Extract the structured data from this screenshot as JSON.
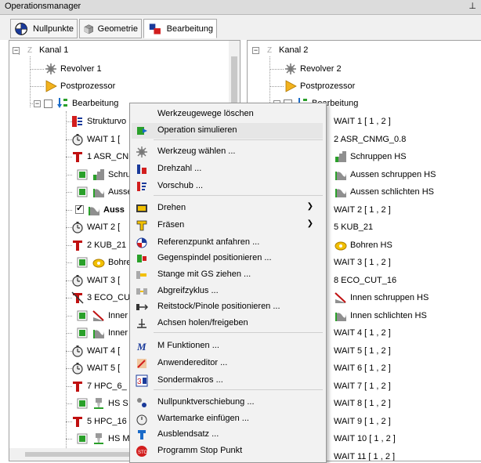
{
  "window": {
    "title": "Operationsmanager",
    "pin_icon": "pin-icon"
  },
  "tabs": [
    {
      "label": "Nullpunkte",
      "icon": "crosshair-icon",
      "active": false
    },
    {
      "label": "Geometrie",
      "icon": "cube-icon",
      "active": false
    },
    {
      "label": "Bearbeitung",
      "icon": "machining-icon",
      "active": true
    }
  ],
  "left_tree": {
    "kanal": "Kanal 1",
    "revolver": "Revolver 1",
    "postprozessor": "Postprozessor",
    "bearbeitung": "Bearbeitung",
    "items": [
      {
        "label": "Strukturvo",
        "icon": "structure-icon",
        "checkbox": false
      },
      {
        "label": "WAIT 1 [",
        "icon": "stopwatch-icon",
        "checkbox": false
      },
      {
        "label": "1 ASR_CN",
        "icon": "tool-t-icon",
        "checkbox": false
      },
      {
        "label": "Schru",
        "icon": "roughing-icon",
        "checkbox": true,
        "checked": false
      },
      {
        "label": "Aussen",
        "icon": "contour-icon",
        "checkbox": true,
        "checked": false
      },
      {
        "label": "Auss",
        "icon": "contour-icon",
        "checkbox": true,
        "checked": true,
        "bold": true
      },
      {
        "label": "WAIT 2 [",
        "icon": "stopwatch-icon",
        "checkbox": false
      },
      {
        "label": "2 KUB_21",
        "icon": "tool-t-icon",
        "checkbox": false
      },
      {
        "label": "Bohre",
        "icon": "drill-icon",
        "checkbox": true,
        "checked": false
      },
      {
        "label": "WAIT 3 [",
        "icon": "stopwatch-icon",
        "checkbox": false
      },
      {
        "label": "3 ECO_CU",
        "icon": "tool-t-crossed-icon",
        "checkbox": false
      },
      {
        "label": "Inner",
        "icon": "cutoff-icon",
        "checkbox": true,
        "checked": false
      },
      {
        "label": "Inner",
        "icon": "contour-icon",
        "checkbox": true,
        "checked": false
      },
      {
        "label": "WAIT 4 [",
        "icon": "stopwatch-icon",
        "checkbox": false
      },
      {
        "label": "WAIT 5 [",
        "icon": "stopwatch-icon",
        "checkbox": false
      },
      {
        "label": "7 HPC_6_",
        "icon": "tool-t-icon",
        "checkbox": false
      },
      {
        "label": "HS S",
        "icon": "spindle-icon",
        "checkbox": true,
        "checked": false
      },
      {
        "label": "5 HPC_16",
        "icon": "tool-t-icon",
        "checkbox": false
      },
      {
        "label": "HS M",
        "icon": "spindle-icon",
        "checkbox": true,
        "checked": false
      }
    ]
  },
  "right_tree": {
    "kanal": "Kanal 2",
    "revolver": "Revolver 2",
    "postprozessor": "Postprozessor",
    "bearbeitung": "Bearbeitung",
    "items": [
      {
        "label": "WAIT 1 [ 1 , 2 ]"
      },
      {
        "label": "2 ASR_CNMG_0.8"
      },
      {
        "label": "Schruppen HS",
        "icon": "roughing-icon"
      },
      {
        "label": "Aussen schruppen HS",
        "icon": "contour-icon"
      },
      {
        "label": "Aussen schlichten HS",
        "icon": "contour-icon"
      },
      {
        "label": "WAIT 2 [ 1 , 2 ]"
      },
      {
        "label": "5 KUB_21"
      },
      {
        "label": "Bohren HS",
        "icon": "drill-icon"
      },
      {
        "label": "WAIT 3 [ 1 , 2 ]"
      },
      {
        "label": "8 ECO_CUT_16"
      },
      {
        "label": "Innen schruppen HS",
        "icon": "cutoff-icon"
      },
      {
        "label": "Innen schlichten HS",
        "icon": "contour-icon"
      },
      {
        "label": "WAIT 4 [ 1 , 2 ]"
      },
      {
        "label": "WAIT 5 [ 1 , 2 ]"
      },
      {
        "label": "WAIT 6 [ 1 , 2 ]"
      },
      {
        "label": "WAIT 7 [ 1 , 2 ]"
      },
      {
        "label": "WAIT 8 [ 1 , 2 ]"
      },
      {
        "label": "WAIT 9 [ 1 , 2 ]"
      },
      {
        "label": "WAIT 10 [ 1 , 2 ]"
      },
      {
        "label": "WAIT 11 [ 1 , 2 ]"
      }
    ]
  },
  "context_menu": {
    "items": [
      {
        "label": "Werkzeugewege löschen",
        "icon": "none"
      },
      {
        "label": "Operation simulieren",
        "icon": "simulate-icon",
        "highlighted": true
      },
      {
        "label": "Werkzeug wählen ...",
        "icon": "tool-select-icon"
      },
      {
        "label": "Drehzahl ...",
        "icon": "speed-icon"
      },
      {
        "label": "Vorschub ...",
        "icon": "feed-icon"
      },
      {
        "label": "Drehen",
        "icon": "turning-icon",
        "submenu": true
      },
      {
        "label": "Fräsen",
        "icon": "milling-icon",
        "submenu": true
      },
      {
        "label": "Referenzpunkt anfahren ...",
        "icon": "reference-icon"
      },
      {
        "label": "Gegenspindel positionieren ...",
        "icon": "counter-spindle-icon"
      },
      {
        "label": "Stange mit GS ziehen ...",
        "icon": "bar-pull-icon"
      },
      {
        "label": "Abgreifzyklus ...",
        "icon": "pickup-icon"
      },
      {
        "label": "Reitstock/Pinole positionieren ...",
        "icon": "tailstock-icon"
      },
      {
        "label": "Achsen holen/freigeben",
        "icon": "axes-icon"
      },
      {
        "label": "M Funktionen ...",
        "icon": "m-function-icon"
      },
      {
        "label": "Anwendereditor ...",
        "icon": "user-editor-icon"
      },
      {
        "label": "Sondermakros ...",
        "icon": "macro-icon"
      },
      {
        "label": "Nullpunktverschiebung ...",
        "icon": "zero-offset-icon"
      },
      {
        "label": "Wartemarke einfügen ...",
        "icon": "wait-mark-icon"
      },
      {
        "label": "Ausblendsatz ...",
        "icon": "skip-block-icon"
      },
      {
        "label": "Programm Stop Punkt",
        "icon": "stop-icon"
      }
    ]
  }
}
